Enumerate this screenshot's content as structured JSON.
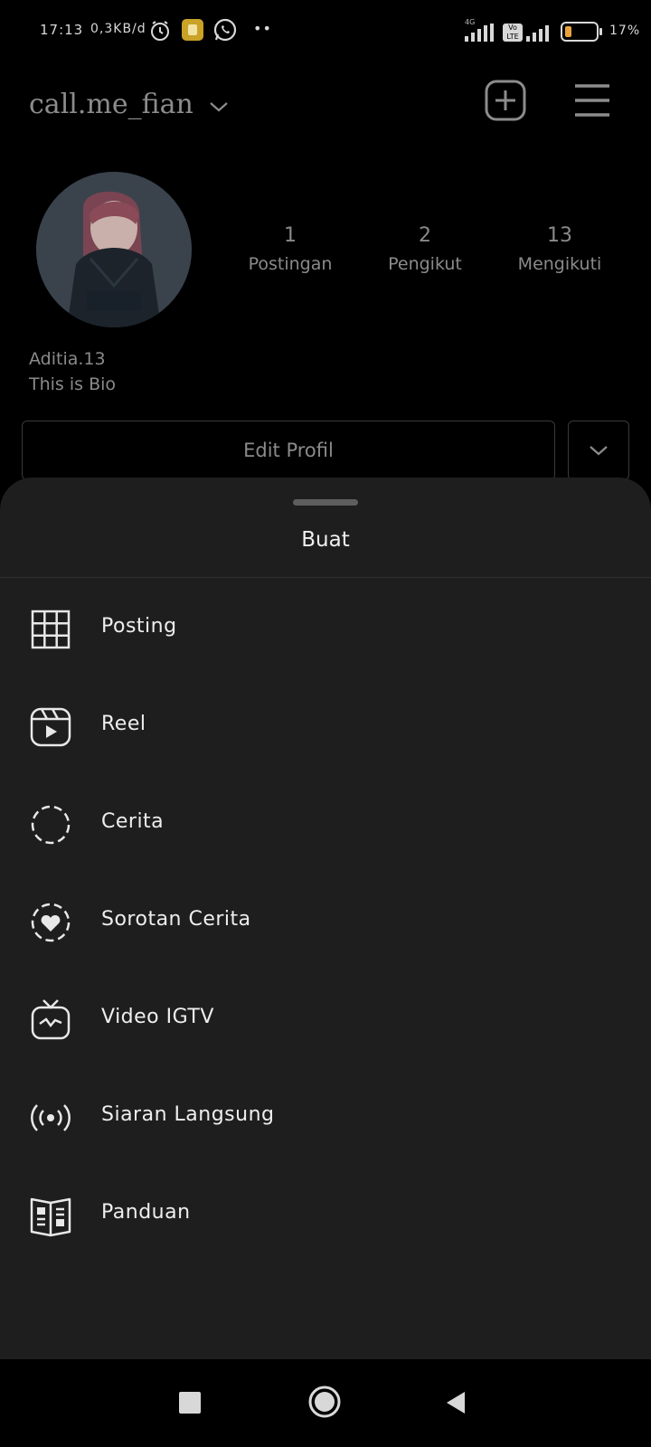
{
  "status_bar": {
    "time": "17:13",
    "speed": "0,3KB/d",
    "network_label": "4G",
    "volte_label": "Vo LTE",
    "battery": "17%"
  },
  "profile": {
    "username": "call.me_fian",
    "stats": [
      {
        "value": "1",
        "label": "Postingan"
      },
      {
        "value": "2",
        "label": "Pengikut"
      },
      {
        "value": "13",
        "label": "Mengikuti"
      }
    ],
    "full_name": "Aditia.13",
    "bio": "This is Bio",
    "edit_button": "Edit Profil"
  },
  "sheet": {
    "title": "Buat",
    "items": [
      {
        "label": "Posting",
        "icon": "grid-icon"
      },
      {
        "label": "Reel",
        "icon": "reel-icon"
      },
      {
        "label": "Cerita",
        "icon": "story-icon"
      },
      {
        "label": "Sorotan Cerita",
        "icon": "highlight-heart-icon"
      },
      {
        "label": "Video IGTV",
        "icon": "igtv-icon"
      },
      {
        "label": "Siaran Langsung",
        "icon": "live-broadcast-icon"
      },
      {
        "label": "Panduan",
        "icon": "guide-book-icon"
      }
    ]
  },
  "colors": {
    "sheet_bg": "#1e1e1e",
    "background": "#000000",
    "text": "#eeeeee",
    "battery_level": "#e8a33c"
  }
}
